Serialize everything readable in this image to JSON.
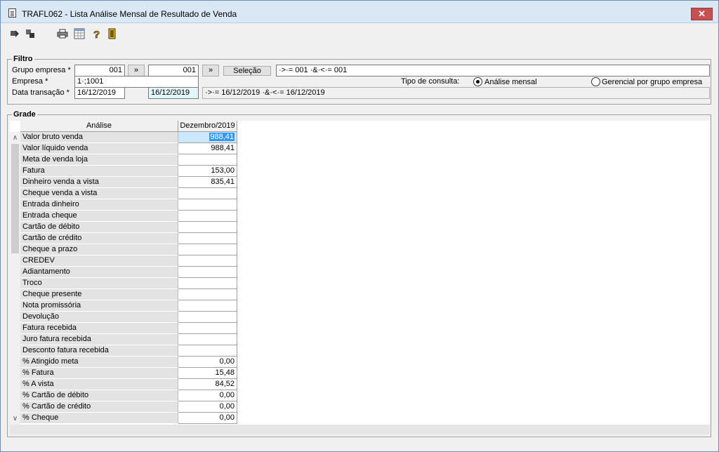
{
  "window": {
    "title": "TRAFL062 - Lista Análise Mensal de Resultado de Venda",
    "close_label": "✕"
  },
  "toolbar": {
    "icons": [
      "first-record-icon",
      "copy-icon",
      "print-icon",
      "calculator-icon",
      "help-icon",
      "exit-door-icon"
    ]
  },
  "filter": {
    "legend": "Filtro",
    "grupo_empresa_label": "Grupo empresa *",
    "grupo_from": "001",
    "arrow1": "»",
    "grupo_to": "001",
    "arrow2": "»",
    "selecao_label": "Seleção",
    "grupo_expr": "·>·= 001 ·&·<·= 001",
    "empresa_label": "Empresa *",
    "empresa_value": "1·;1001",
    "tipo_consulta_label": "Tipo de consulta:",
    "radio_analise": "Análise mensal",
    "radio_gerencial": "Gerencial por grupo empresa",
    "data_label": "Data transação *",
    "data_from": "16/12/2019",
    "data_to": "16/12/2019",
    "data_expr": "·>·= 16/12/2019 ·&·<·= 16/12/2019"
  },
  "grid": {
    "legend": "Grade",
    "col_analise": "Análise",
    "col_mes": "Dezembro/2019",
    "rows": [
      {
        "label": "Valor bruto venda",
        "value": "988,41"
      },
      {
        "label": "Valor líquido venda",
        "value": "988,41"
      },
      {
        "label": "Meta de venda loja",
        "value": ""
      },
      {
        "label": "Fatura",
        "value": "153,00"
      },
      {
        "label": "Dinheiro venda a vista",
        "value": "835,41"
      },
      {
        "label": "Cheque venda a vista",
        "value": ""
      },
      {
        "label": "Entrada dinheiro",
        "value": ""
      },
      {
        "label": "Entrada cheque",
        "value": ""
      },
      {
        "label": "Cartão de débito",
        "value": ""
      },
      {
        "label": "Cartão de crédito",
        "value": ""
      },
      {
        "label": "Cheque a prazo",
        "value": ""
      },
      {
        "label": "CREDEV",
        "value": ""
      },
      {
        "label": "Adiantamento",
        "value": ""
      },
      {
        "label": "Troco",
        "value": ""
      },
      {
        "label": "Cheque presente",
        "value": ""
      },
      {
        "label": "Nota promissória",
        "value": ""
      },
      {
        "label": "Devolução",
        "value": ""
      },
      {
        "label": "Fatura recebida",
        "value": ""
      },
      {
        "label": "Juro fatura recebida",
        "value": ""
      },
      {
        "label": "Desconto fatura recebida",
        "value": ""
      },
      {
        "label": "% Atingido meta",
        "value": "0,00"
      },
      {
        "label": "% Fatura",
        "value": "15,48"
      },
      {
        "label": "% A vista",
        "value": "84,52"
      },
      {
        "label": "% Cartão de débito",
        "value": "0,00"
      },
      {
        "label": "% Cartão de crédito",
        "value": "0,00"
      },
      {
        "label": "% Cheque",
        "value": "0,00"
      }
    ]
  }
}
